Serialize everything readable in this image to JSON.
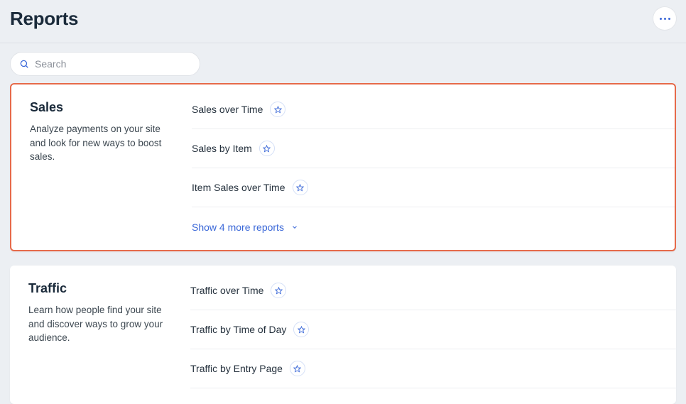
{
  "header": {
    "title": "Reports"
  },
  "search": {
    "placeholder": "Search"
  },
  "categories": [
    {
      "title": "Sales",
      "description": "Analyze payments on your site and look for new ways to boost sales.",
      "highlighted": true,
      "reports": [
        {
          "name": "Sales over Time"
        },
        {
          "name": "Sales by Item"
        },
        {
          "name": "Item Sales over Time"
        }
      ],
      "show_more": "Show 4 more reports"
    },
    {
      "title": "Traffic",
      "description": "Learn how people find your site and discover ways to grow your audience.",
      "highlighted": false,
      "reports": [
        {
          "name": "Traffic over Time"
        },
        {
          "name": "Traffic by Time of Day"
        },
        {
          "name": "Traffic by Entry Page"
        }
      ],
      "show_more": ""
    }
  ]
}
